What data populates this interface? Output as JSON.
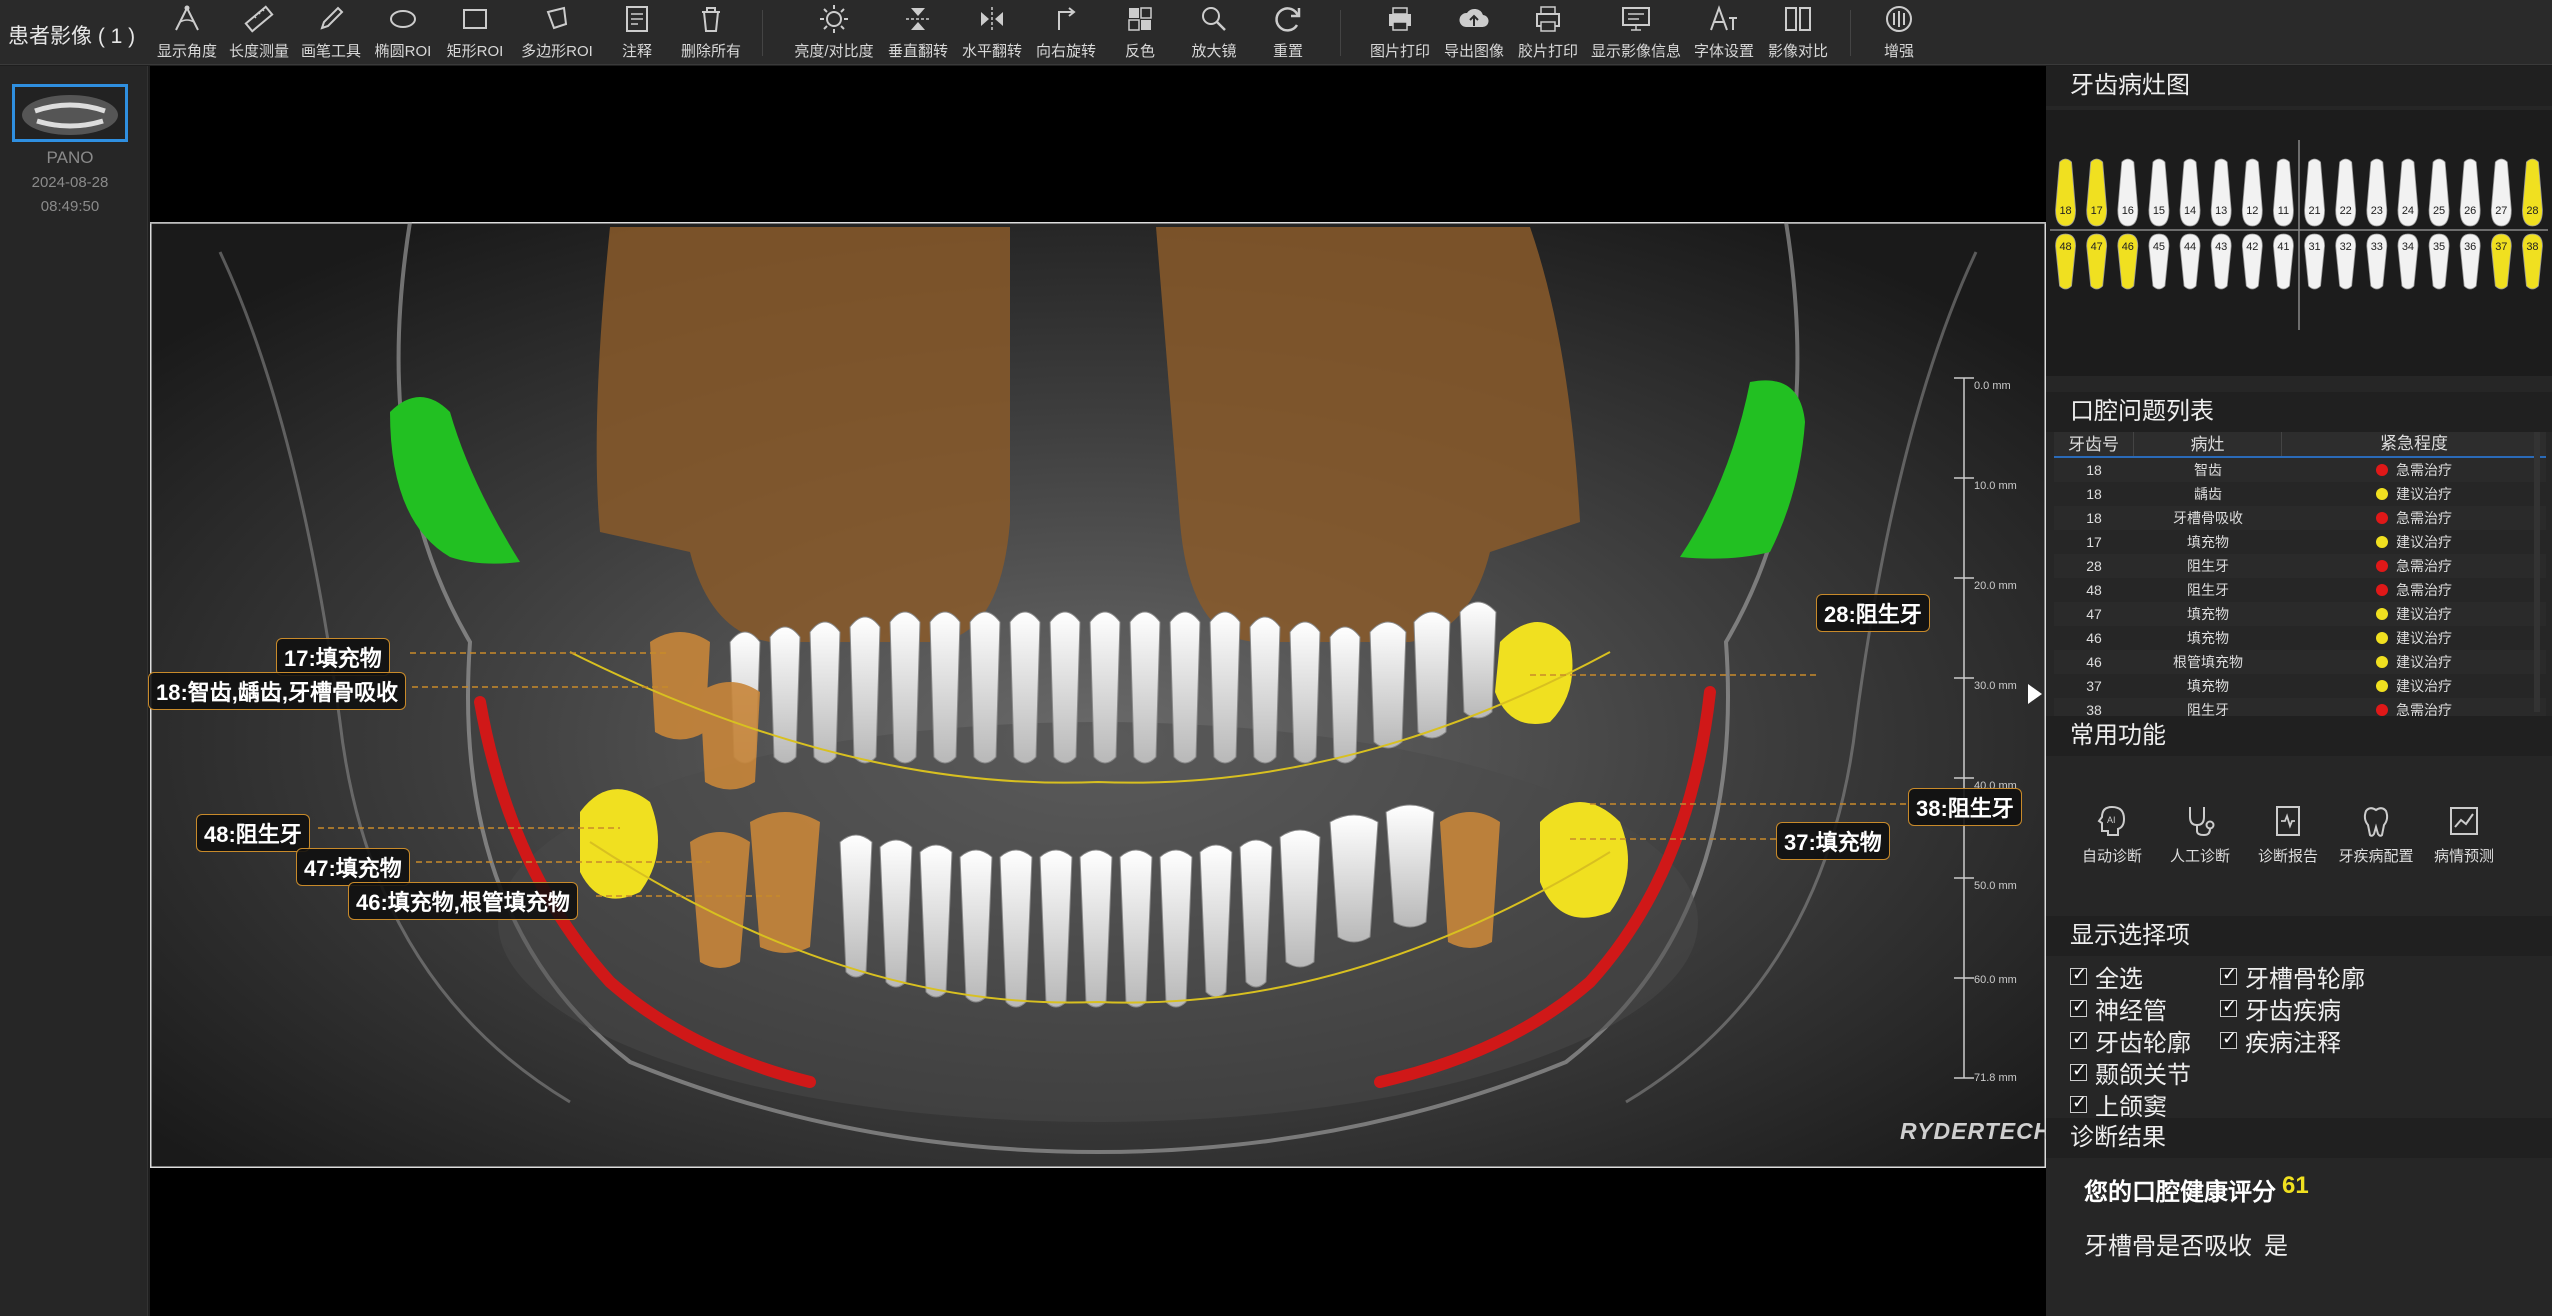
{
  "patient_title": "患者影像 ( 1 )",
  "toolbar": {
    "tools": [
      {
        "label": "显示角度",
        "icon": "angle-icon"
      },
      {
        "label": "长度测量",
        "icon": "ruler-icon"
      },
      {
        "label": "画笔工具",
        "icon": "pen-icon"
      },
      {
        "label": "椭圆ROI",
        "icon": "ellipse-icon"
      },
      {
        "label": "矩形ROI",
        "icon": "rectangle-icon"
      },
      {
        "label": "多边形ROI",
        "icon": "polygon-icon"
      },
      {
        "label": "注释",
        "icon": "annotation-icon"
      },
      {
        "label": "删除所有",
        "icon": "trash-icon"
      },
      {
        "label": "亮度/对比度",
        "icon": "brightness-icon"
      },
      {
        "label": "垂直翻转",
        "icon": "vertical-flip-icon"
      },
      {
        "label": "水平翻转",
        "icon": "horizontal-flip-icon"
      },
      {
        "label": "向右旋转",
        "icon": "rotate-right-icon"
      },
      {
        "label": "反色",
        "icon": "invert-icon"
      },
      {
        "label": "放大镜",
        "icon": "magnifier-icon"
      },
      {
        "label": "重置",
        "icon": "reset-icon"
      },
      {
        "label": "图片打印",
        "icon": "print-image-icon"
      },
      {
        "label": "导出图像",
        "icon": "export-cloud-icon"
      },
      {
        "label": "胶片打印",
        "icon": "film-print-icon"
      },
      {
        "label": "显示影像信息",
        "icon": "monitor-info-icon"
      },
      {
        "label": "字体设置",
        "icon": "font-icon"
      },
      {
        "label": "影像对比",
        "icon": "compare-icon"
      },
      {
        "label": "增强",
        "icon": "enhance-icon"
      }
    ]
  },
  "thumbnail": {
    "modality": "PANO",
    "date": "2024-08-28",
    "time": "08:49:50"
  },
  "viewer": {
    "annotations": [
      {
        "text": "17:填充物"
      },
      {
        "text": "18:智齿,龋齿,牙槽骨吸收"
      },
      {
        "text": "48:阻生牙"
      },
      {
        "text": "47:填充物"
      },
      {
        "text": "46:填充物,根管填充物"
      },
      {
        "text": "28:阻生牙"
      },
      {
        "text": "38:阻生牙"
      },
      {
        "text": "37:填充物"
      }
    ],
    "scale_labels": [
      "0.0 mm",
      "10.0 mm",
      "20.0 mm",
      "30.0 mm",
      "40.0 mm",
      "50.0 mm",
      "60.0 mm",
      "71.8 mm"
    ],
    "logo": "RYDERTECH"
  },
  "right_panel": {
    "tooth_chart_title": "牙齿病灶图",
    "upper_teeth": [
      "18",
      "17",
      "16",
      "15",
      "14",
      "13",
      "12",
      "11",
      "21",
      "22",
      "23",
      "24",
      "25",
      "26",
      "27",
      "28"
    ],
    "lower_teeth": [
      "48",
      "47",
      "46",
      "45",
      "44",
      "43",
      "42",
      "41",
      "31",
      "32",
      "33",
      "34",
      "35",
      "36",
      "37",
      "38"
    ],
    "highlighted_teeth": [
      "18",
      "17",
      "28",
      "48",
      "47",
      "46",
      "37",
      "38"
    ],
    "issues_title": "口腔问题列表",
    "issue_columns": [
      "牙齿号",
      "病灶",
      "紧急程度"
    ],
    "issues": [
      {
        "tooth": "18",
        "lesion": "智齿",
        "urgency": "急需治疗",
        "color": "#e01818"
      },
      {
        "tooth": "18",
        "lesion": "龋齿",
        "urgency": "建议治疗",
        "color": "#f0e020"
      },
      {
        "tooth": "18",
        "lesion": "牙槽骨吸收",
        "urgency": "急需治疗",
        "color": "#e01818"
      },
      {
        "tooth": "17",
        "lesion": "填充物",
        "urgency": "建议治疗",
        "color": "#f0e020"
      },
      {
        "tooth": "28",
        "lesion": "阻生牙",
        "urgency": "急需治疗",
        "color": "#e01818"
      },
      {
        "tooth": "48",
        "lesion": "阻生牙",
        "urgency": "急需治疗",
        "color": "#e01818"
      },
      {
        "tooth": "47",
        "lesion": "填充物",
        "urgency": "建议治疗",
        "color": "#f0e020"
      },
      {
        "tooth": "46",
        "lesion": "填充物",
        "urgency": "建议治疗",
        "color": "#f0e020"
      },
      {
        "tooth": "46",
        "lesion": "根管填充物",
        "urgency": "建议治疗",
        "color": "#f0e020"
      },
      {
        "tooth": "37",
        "lesion": "填充物",
        "urgency": "建议治疗",
        "color": "#f0e020"
      },
      {
        "tooth": "38",
        "lesion": "阻生牙",
        "urgency": "急需治疗",
        "color": "#e01818"
      }
    ],
    "functions_title": "常用功能",
    "functions": [
      {
        "label": "自动诊断",
        "icon": "ai-diagnosis-icon"
      },
      {
        "label": "人工诊断",
        "icon": "stethoscope-icon"
      },
      {
        "label": "诊断报告",
        "icon": "report-icon"
      },
      {
        "label": "牙疾病配置",
        "icon": "tooth-config-icon"
      },
      {
        "label": "病情预测",
        "icon": "prediction-chart-icon"
      }
    ],
    "display_title": "显示选择项",
    "display_options_left": [
      "全选",
      "神经管",
      "牙齿轮廓",
      "颞颌关节",
      "上颌窦"
    ],
    "display_options_right": [
      "牙槽骨轮廓",
      "牙齿疾病",
      "疾病注释"
    ],
    "result_title": "诊断结果",
    "score_label": "您的口腔健康评分",
    "score_value": "61",
    "bone_label": "牙槽骨是否吸收",
    "bone_value": "是"
  },
  "colors": {
    "accent_blue": "#2f8fe0",
    "highlight_yellow": "#f0e020",
    "urgent_red": "#e01818",
    "sinus_brown": "#8a5a2a",
    "tmj_green": "#22c022",
    "nerve_red": "#d01818",
    "filling_orange": "#c8863a"
  }
}
